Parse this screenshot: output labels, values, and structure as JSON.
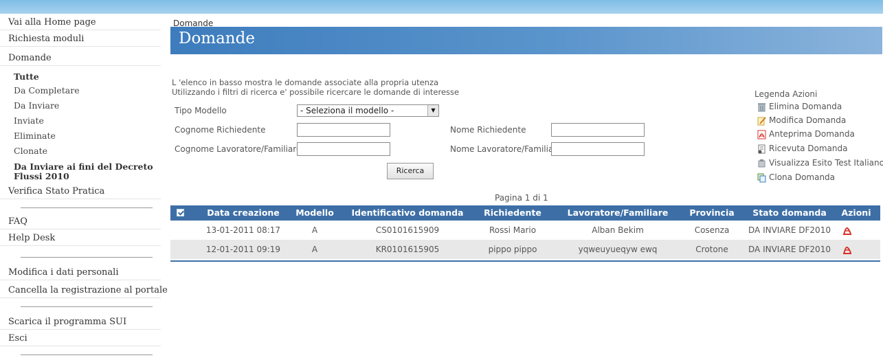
{
  "sidebar": {
    "home": "Vai alla Home page",
    "richiesta": "Richiesta moduli",
    "domande": "Domande",
    "sub": {
      "tutte": "Tutte",
      "completare": "Da Completare",
      "inviare": "Da Inviare",
      "inviate": "Inviate",
      "eliminate": "Eliminate",
      "clonate": "Clonate",
      "decreto": "Da Inviare ai fini del Decreto Flussi 2010"
    },
    "verifica": "Verifica Stato Pratica",
    "faq": "FAQ",
    "help": "Help Desk",
    "modifica": "Modifica i dati personali",
    "cancella": "Cancella la registrazione al portale",
    "scarica": "Scarica il programma SUI",
    "esci": "Esci"
  },
  "breadcrumb": "Domande",
  "page_title": "Domande",
  "intro": {
    "line1": "L 'elenco in basso mostra le domande associate alla propria utenza",
    "line2": "Utilizzando i filtri di ricerca e' possibile ricercare le domande di interesse"
  },
  "filters": {
    "tipo_modello_label": "Tipo Modello",
    "tipo_modello_value": "- Seleziona il modello -",
    "cognome_richiedente_label": "Cognome Richiedente",
    "nome_richiedente_label": "Nome Richiedente",
    "cognome_lavoratore_label": "Cognome Lavoratore/Familiare",
    "nome_lavoratore_label": "Nome Lavoratore/Familiare",
    "search_button": "Ricerca"
  },
  "legend": {
    "title": "Legenda Azioni",
    "items": [
      "Elimina Domanda",
      "Modifica Domanda",
      "Anteprima Domanda",
      "Ricevuta Domanda",
      "Visualizza Esito Test Italiano",
      "Clona Domanda"
    ]
  },
  "pagination": "Pagina 1 di 1",
  "table": {
    "headers": [
      "Data creazione",
      "Modello",
      "Identificativo domanda",
      "Richiedente",
      "Lavoratore/Familiare",
      "Provincia",
      "Stato domanda",
      "Azioni"
    ],
    "rows": [
      [
        "13-01-2011 08:17",
        "A",
        "CS0101615909",
        "Rossi Mario",
        "Alban Bekim",
        "Cosenza",
        "DA INVIARE DF2010"
      ],
      [
        "12-01-2011 09:19",
        "A",
        "KR0101615905",
        "pippo pippo",
        "yqweuyueqyw ewq",
        "Crotone",
        "DA INVIARE DF2010"
      ]
    ]
  },
  "colors": {
    "header_blue": "#3d6fa6",
    "title_band": "#3d7cbd",
    "pdf_red": "#d8322a"
  }
}
